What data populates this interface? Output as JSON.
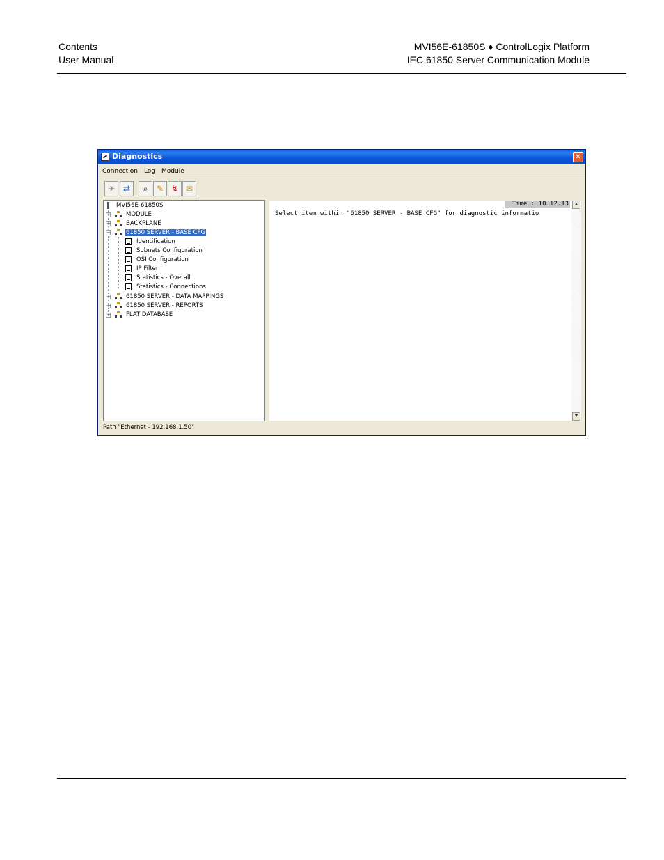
{
  "header": {
    "left_line1": "Contents",
    "left_line2": "User Manual",
    "right_line1": "MVI56E-61850S ♦ ControlLogix Platform",
    "right_line2": "IEC 61850 Server Communication Module"
  },
  "window": {
    "title": "Diagnostics",
    "close_glyph": "×",
    "menu": [
      "Connection",
      "Log",
      "Module"
    ],
    "toolbar_icons": [
      "disconnect-icon",
      "connect-icon",
      "find-icon",
      "new-log-icon",
      "export-icon",
      "email-icon"
    ],
    "tree": {
      "root": "MVI56E-61850S",
      "items": [
        {
          "label": "MODULE",
          "expanded": false
        },
        {
          "label": "BACKPLANE",
          "expanded": false
        },
        {
          "label": "61850 SERVER - BASE CFG",
          "expanded": true,
          "selected": true,
          "children": [
            "Identification",
            "Subnets Configuration",
            "OSI Configuration",
            "IP Filter",
            "Statistics - Overall",
            "Statistics - Connections"
          ]
        },
        {
          "label": "61850 SERVER - DATA MAPPINGS",
          "expanded": false
        },
        {
          "label": "61850 SERVER - REPORTS",
          "expanded": false
        },
        {
          "label": "FLAT DATABASE",
          "expanded": false
        }
      ]
    },
    "time_label": "Time : 10.12.13",
    "message": "Select item within \"61850 SERVER - BASE CFG\" for diagnostic informatio",
    "status": "Path \"Ethernet - 192.168.1.50\""
  },
  "colors": {
    "title_bar": "#0a56d8",
    "selection": "#316ac5",
    "close_button": "#e15a33"
  }
}
